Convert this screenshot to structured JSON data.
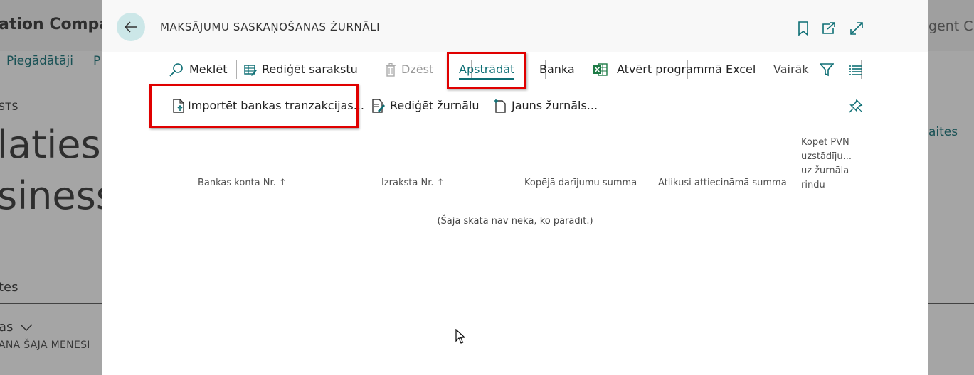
{
  "background": {
    "company": "ation Compan",
    "right_text": "gent Clo",
    "nav_item_1": "Piegādātāji",
    "nav_item_2": "P",
    "section_label": "STS",
    "headline_line1": "laties u",
    "headline_line2": "siness",
    "right_link": "aites",
    "section2_label": "tes",
    "filter_label": "as",
    "subheading": "ANA ŠAJĀ MĒNESĪ"
  },
  "dialog": {
    "title": "MAKSĀJUMU SASKAŅOŠANAS ŽURNĀLI",
    "header_icons": [
      "bookmark-icon",
      "open-in-new-window-icon",
      "expand-icon"
    ],
    "actions": {
      "search": "Meklēt",
      "edit_list": "Rediģēt sarakstu",
      "delete": "Dzēst",
      "process": "Apstrādāt",
      "bank": "Banka",
      "excel": "Atvērt programmā Excel",
      "more": "Vairāk"
    },
    "process_actions": {
      "import": "Importēt bankas tranzakcijas...",
      "edit_journal": "Rediģēt žurnālu",
      "new_journal": "Jauns žurnāls..."
    },
    "columns": {
      "bank_account": "Bankas konta Nr.",
      "statement": "Izraksta Nr.",
      "total": "Kopējā darījumu summa",
      "balance": "Atlikusi attiecināmā summa",
      "copy_vat_1": "Kopēt PVN",
      "copy_vat_2": "uzstādīju...",
      "copy_vat_3": "uz žurnāla",
      "copy_vat_4": "rindu"
    },
    "sort_icon": "↑",
    "empty_message": "(Šajā skatā nav nekā, ko parādīt.)"
  },
  "colors": {
    "accent": "#0e6f75",
    "highlight": "#e00000",
    "excel_green": "#1d7a45"
  }
}
